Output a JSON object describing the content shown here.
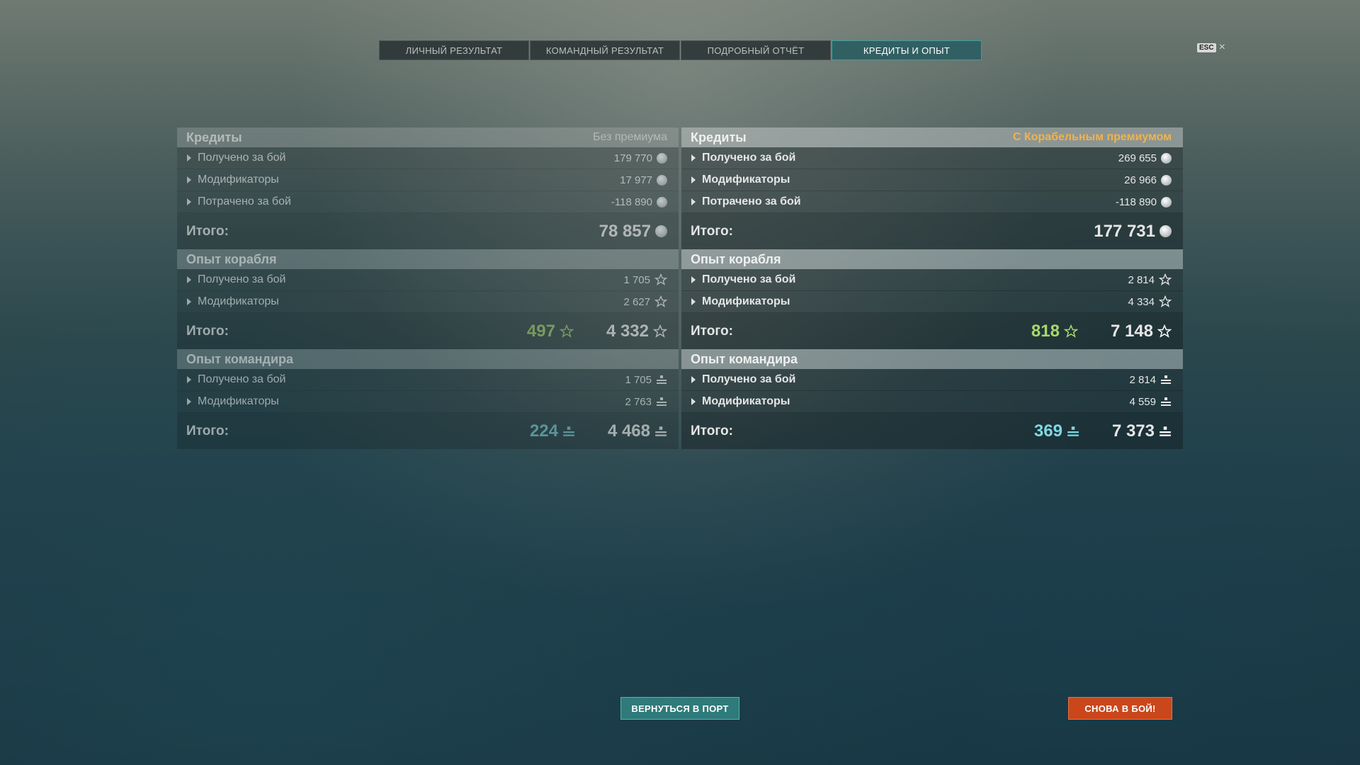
{
  "tabs": [
    {
      "label": "ЛИЧНЫЙ РЕЗУЛЬТАТ",
      "active": false
    },
    {
      "label": "КОМАНДНЫЙ РЕЗУЛЬТАТ",
      "active": false
    },
    {
      "label": "ПОДРОБНЫЙ ОТЧЁТ",
      "active": false
    },
    {
      "label": "КРЕДИТЫ И ОПЫТ",
      "active": true
    }
  ],
  "esc": {
    "key": "ESC",
    "close": "×"
  },
  "left": {
    "credits": {
      "title": "Кредиты",
      "note": "Без премиума",
      "rows": [
        {
          "label": "Получено за бой",
          "value": "179 770",
          "icon": "credits-icon"
        },
        {
          "label": "Модификаторы",
          "value": "17 977",
          "icon": "credits-icon"
        },
        {
          "label": "Потрачено за бой",
          "value": "-118 890",
          "icon": "credits-icon"
        }
      ],
      "total_label": "Итого:",
      "total": "78 857"
    },
    "ship_xp": {
      "title": "Опыт корабля",
      "rows": [
        {
          "label": "Получено за бой",
          "value": "1 705",
          "icon": "star-icon"
        },
        {
          "label": "Модификаторы",
          "value": "2 627",
          "icon": "star-icon"
        }
      ],
      "total_label": "Итого:",
      "free": "497",
      "total": "4 332"
    },
    "commander_xp": {
      "title": "Опыт командира",
      "rows": [
        {
          "label": "Получено за бой",
          "value": "1 705",
          "icon": "commander-xp-icon"
        },
        {
          "label": "Модификаторы",
          "value": "2 763",
          "icon": "commander-xp-icon"
        }
      ],
      "total_label": "Итого:",
      "free": "224",
      "total": "4 468"
    }
  },
  "right": {
    "credits": {
      "title": "Кредиты",
      "note": "С Корабельным премиумом",
      "rows": [
        {
          "label": "Получено за бой",
          "value": "269 655",
          "icon": "credits-icon"
        },
        {
          "label": "Модификаторы",
          "value": "26 966",
          "icon": "credits-icon"
        },
        {
          "label": "Потрачено за бой",
          "value": "-118 890",
          "icon": "credits-icon"
        }
      ],
      "total_label": "Итого:",
      "total": "177 731"
    },
    "ship_xp": {
      "title": "Опыт корабля",
      "rows": [
        {
          "label": "Получено за бой",
          "value": "2 814",
          "icon": "star-icon"
        },
        {
          "label": "Модификаторы",
          "value": "4 334",
          "icon": "star-icon"
        }
      ],
      "total_label": "Итого:",
      "free": "818",
      "total": "7 148"
    },
    "commander_xp": {
      "title": "Опыт командира",
      "rows": [
        {
          "label": "Получено за бой",
          "value": "2 814",
          "icon": "commander-xp-icon"
        },
        {
          "label": "Модификаторы",
          "value": "4 559",
          "icon": "commander-xp-icon"
        }
      ],
      "total_label": "Итого:",
      "free": "369",
      "total": "7 373"
    }
  },
  "buttons": {
    "port": "ВЕРНУТЬСЯ В ПОРТ",
    "battle": "СНОВА В БОЙ!"
  },
  "colors": {
    "accent": "#2f7a7a",
    "premium": "#f2b24a",
    "battle": "#c9471b",
    "free_ship_xp": "#a8d86a",
    "free_commander_xp": "#7fd8e0"
  }
}
